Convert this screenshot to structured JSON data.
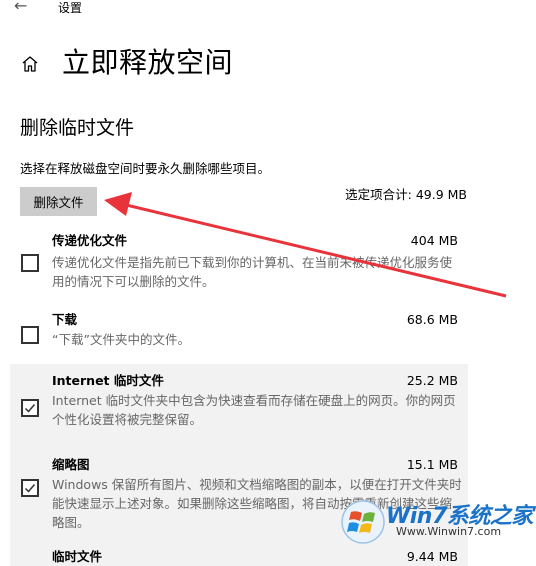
{
  "window": {
    "back_glyph": "←",
    "title": "设置"
  },
  "page": {
    "title": "立即释放空间",
    "section_title": "删除临时文件",
    "description": "选择在释放磁盘空间时要永久删除哪些项目。",
    "delete_button_label": "删除文件",
    "total_label": "选定项合计: 49.9 MB"
  },
  "items": [
    {
      "name": "传递优化文件",
      "size": "404 MB",
      "checked": false,
      "description": "传递优化文件是指先前已下载到你的计算机、在当前未被传递优化服务使用的情况下可以删除的文件。"
    },
    {
      "name": "下载",
      "size": "68.6 MB",
      "checked": false,
      "description": "“下载”文件夹中的文件。"
    },
    {
      "name": "Internet 临时文件",
      "size": "25.2 MB",
      "checked": true,
      "description": "Internet 临时文件夹中包含为快速查看而存储在硬盘上的网页。你的网页个性化设置将被完整保留。"
    },
    {
      "name": "缩略图",
      "size": "15.1 MB",
      "checked": true,
      "description": "Windows 保留所有图片、视频和文档缩略图的副本，以便在打开文件夹时能快速显示上述对象。如果删除这些缩略图，将自动按需重新创建这些缩略图。"
    },
    {
      "name": "临时文件",
      "size": "9.44 MB",
      "checked": true,
      "description": ""
    }
  ],
  "watermark": {
    "logo_text": "Win7系统之家",
    "url": "Www.Winwin7.com"
  },
  "colors": {
    "annotation_arrow": "#e8333b",
    "button_bg": "#cccccc",
    "selected_row_bg": "#f2f2f2",
    "watermark_blue": "#1a73c8"
  },
  "icons": {
    "back": "back-arrow-icon",
    "home": "home-icon",
    "checkbox_checked": "checkmark-icon",
    "annotation": "red-arrow-annotation",
    "watermark": "windows-logo-icon"
  }
}
